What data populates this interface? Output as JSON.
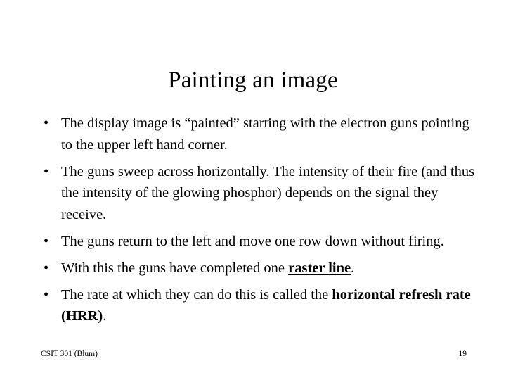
{
  "slide": {
    "title": "Painting an image",
    "bullet_marker": "•",
    "bullets": [
      {
        "id": "bullet-1",
        "segments": [
          {
            "text": "The display image is “painted” starting with the electron guns pointing to the upper left hand corner.",
            "style": "normal"
          }
        ]
      },
      {
        "id": "bullet-2",
        "segments": [
          {
            "text": "The guns sweep across horizontally.  The intensity of their fire (and thus the intensity of the glowing phosphor) depends on the signal they receive.",
            "style": "normal"
          }
        ]
      },
      {
        "id": "bullet-3",
        "segments": [
          {
            "text": "The guns return to the left and move one row down without firing.",
            "style": "normal"
          }
        ]
      },
      {
        "id": "bullet-4",
        "segments": [
          {
            "text": "With this the guns have completed one ",
            "style": "normal"
          },
          {
            "text": "raster line",
            "style": "bold-underline"
          },
          {
            "text": ".",
            "style": "normal"
          }
        ]
      },
      {
        "id": "bullet-5",
        "segments": [
          {
            "text": "The rate at which they can do this is called the ",
            "style": "normal"
          },
          {
            "text": "horizontal refresh rate (HRR)",
            "style": "bold"
          },
          {
            "text": ".",
            "style": "normal"
          }
        ]
      }
    ],
    "footer": {
      "course": "CSIT 301 (Blum)",
      "page_number": "19"
    },
    "colors": {
      "background": "#ffffff",
      "text": "#000000"
    }
  }
}
